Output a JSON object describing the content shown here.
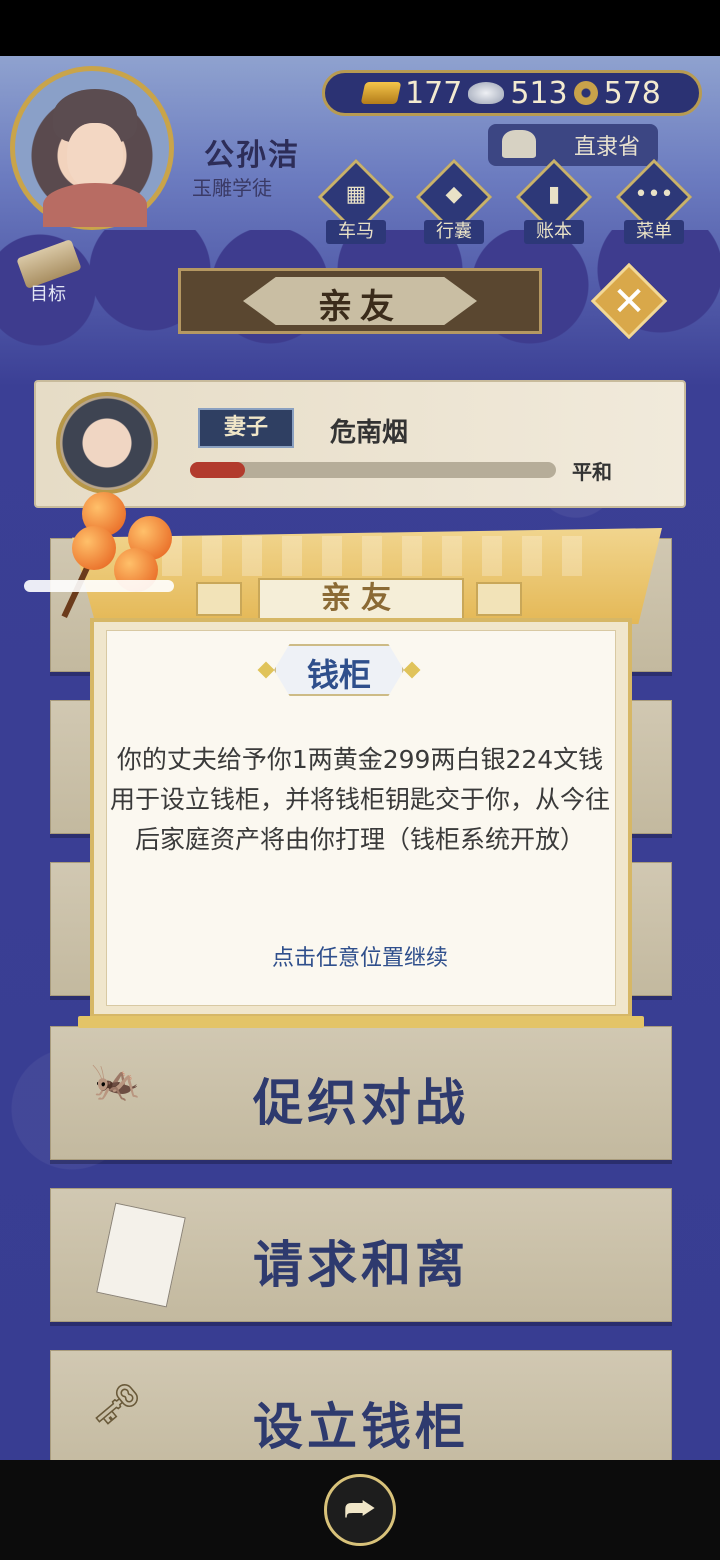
{
  "player": {
    "name": "公孙洁",
    "title": "玉雕学徒"
  },
  "currency": {
    "gold": "177",
    "silver": "513",
    "coins": "578"
  },
  "region": "直隶省",
  "nav": [
    {
      "label": "车马",
      "icon": "carriage-icon"
    },
    {
      "label": "行囊",
      "icon": "bag-icon"
    },
    {
      "label": "账本",
      "icon": "ledger-icon"
    },
    {
      "label": "菜单",
      "icon": "menu-icon"
    }
  ],
  "goal_label": "目标",
  "page_title": "亲友",
  "spouse": {
    "role": "妻子",
    "name": "危南烟",
    "mood": "平和",
    "affection_fraction": 0.15
  },
  "cards": [
    {
      "label": "促织对战",
      "icon": "cricket-icon"
    },
    {
      "label": "请求和离",
      "icon": "divorce-letter-icon"
    },
    {
      "label": "设立钱柜",
      "icon": "key-icon"
    }
  ],
  "dialog": {
    "header": "亲友",
    "subtitle": "钱柜",
    "message": "你的丈夫给予你1两黄金299两白银224文钱用于设立钱柜，并将钱柜钥匙交于你，从今往后家庭资产将由你打理（钱柜系统开放）",
    "continue_hint": "点击任意位置继续"
  },
  "colors": {
    "accent_gold": "#d9a84a",
    "ink_blue": "#2e3a6e",
    "bg_navy": "#3a3f8a"
  }
}
